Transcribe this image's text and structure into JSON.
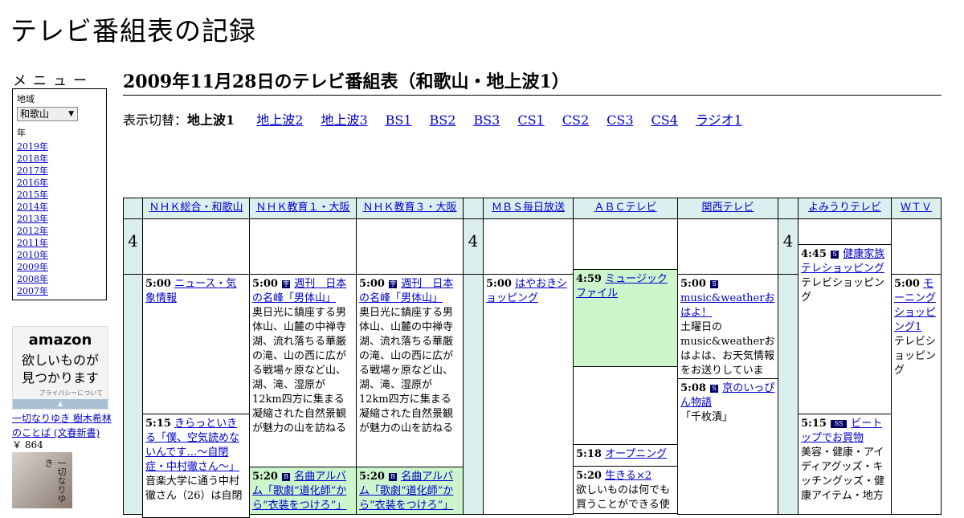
{
  "site_title": "テレビ番組表の記録",
  "menu": {
    "title": "メニュー",
    "region_label": "地域",
    "region_value": "和歌山",
    "year_label": "年",
    "years": [
      "2019年",
      "2018年",
      "2017年",
      "2016年",
      "2015年",
      "2014年",
      "2013年",
      "2012年",
      "2011年",
      "2010年",
      "2009年",
      "2008年",
      "2007年"
    ]
  },
  "ad": {
    "logo": "amazon",
    "tagline1": "欲しいものが",
    "tagline2": "見つかります",
    "privacy": "プライバシーについて"
  },
  "book": {
    "link": "一切なりゆき 樹木希林のことば (文春新書)",
    "price": "￥ 864",
    "cover_title": "一切なりゆき"
  },
  "page_heading": "2009年11月28日のテレビ番組表（和歌山・地上波1）",
  "switcher": {
    "label": "表示切替：",
    "current": "地上波1",
    "links": [
      "地上波2",
      "地上波3",
      "BS1",
      "BS2",
      "BS3",
      "CS1",
      "CS2",
      "CS3",
      "CS4",
      "ラジオ1"
    ]
  },
  "channels": [
    "ＮＨＫ総合・和歌山",
    "ＮＨＫ教育１・大阪",
    "ＮＨＫ教育３・大阪",
    "ＭＢＳ毎日放送",
    "ＡＢＣテレビ",
    "関西テレビ",
    "よみうりテレビ",
    "ＷＴＶ"
  ],
  "hour": "4",
  "programs": {
    "nhk_g_1": {
      "time": "5:00",
      "title": "ニュース・気象情報"
    },
    "nhk_g_2": {
      "time": "5:15",
      "title": "きらっといきる「僕、空気読めないんです…～自閉症・中村徹さん～」",
      "desc": "音楽大学に通う中村徹さん（26）は自閉"
    },
    "nhk_e1_1": {
      "time": "5:00",
      "icon": "字",
      "title": "週刊　日本の名峰「男体山」",
      "desc": "奥日光に鎮座する男体山、山麓の中禅寺湖、流れ落ちる華厳の滝、山の西に広がる戦場ヶ原など山、湖、滝、湿原が12km四方に集まる凝縮された自然景観が魅力の山を訪ねる"
    },
    "nhk_e1_2": {
      "time": "5:20",
      "icon": "B",
      "title": "名曲アルバム「歌劇“道化師”から“衣装をつけろ”」"
    },
    "nhk_e3_1": {
      "time": "5:00",
      "icon": "字",
      "title": "週刊　日本の名峰「男体山」",
      "desc": "奥日光に鎮座する男体山、山麓の中禅寺湖、流れ落ちる華厳の滝、山の西に広がる戦場ヶ原など山、湖、滝、湿原が12km四方に集まる凝縮された自然景観が魅力の山を訪ねる"
    },
    "nhk_e3_2": {
      "time": "5:20",
      "icon": "B",
      "title": "名曲アルバム「歌劇“道化師”から“衣装をつけろ”」"
    },
    "mbs_1": {
      "time": "5:00",
      "title": "はやおきショッピング"
    },
    "abc_1": {
      "time": "4:59",
      "title": "ミュージックファイル"
    },
    "abc_2": {
      "time": "5:18",
      "title": "オープニング"
    },
    "abc_3": {
      "time": "5:20",
      "title": "生きる×2",
      "desc": "欲しいものは何でも買うことができる使"
    },
    "ktv_1": {
      "time": "5:00",
      "icon": "S",
      "title": "music&weatherおはよ！",
      "desc": "土曜日のmusic&weatherおはよは、お天気情報をお送りしています。"
    },
    "ktv_2": {
      "time": "5:08",
      "icon": "S",
      "title": "京のいっぴん物語",
      "desc": "「千枚漬」"
    },
    "ytv_1": {
      "time": "4:45",
      "icon": "S",
      "title": "健康家族テレショッピング",
      "desc": "テレビショッピング"
    },
    "ytv_2": {
      "time": "5:15",
      "icon": "SS",
      "title": "ビートップでお買物",
      "desc": "美容・健康・アイディアグッズ・キッチングッズ・健康アイテム・地方"
    },
    "wtv_1": {
      "time": "5:00",
      "title": "モーニングショッピング1",
      "desc": "テレビショッピング"
    }
  }
}
